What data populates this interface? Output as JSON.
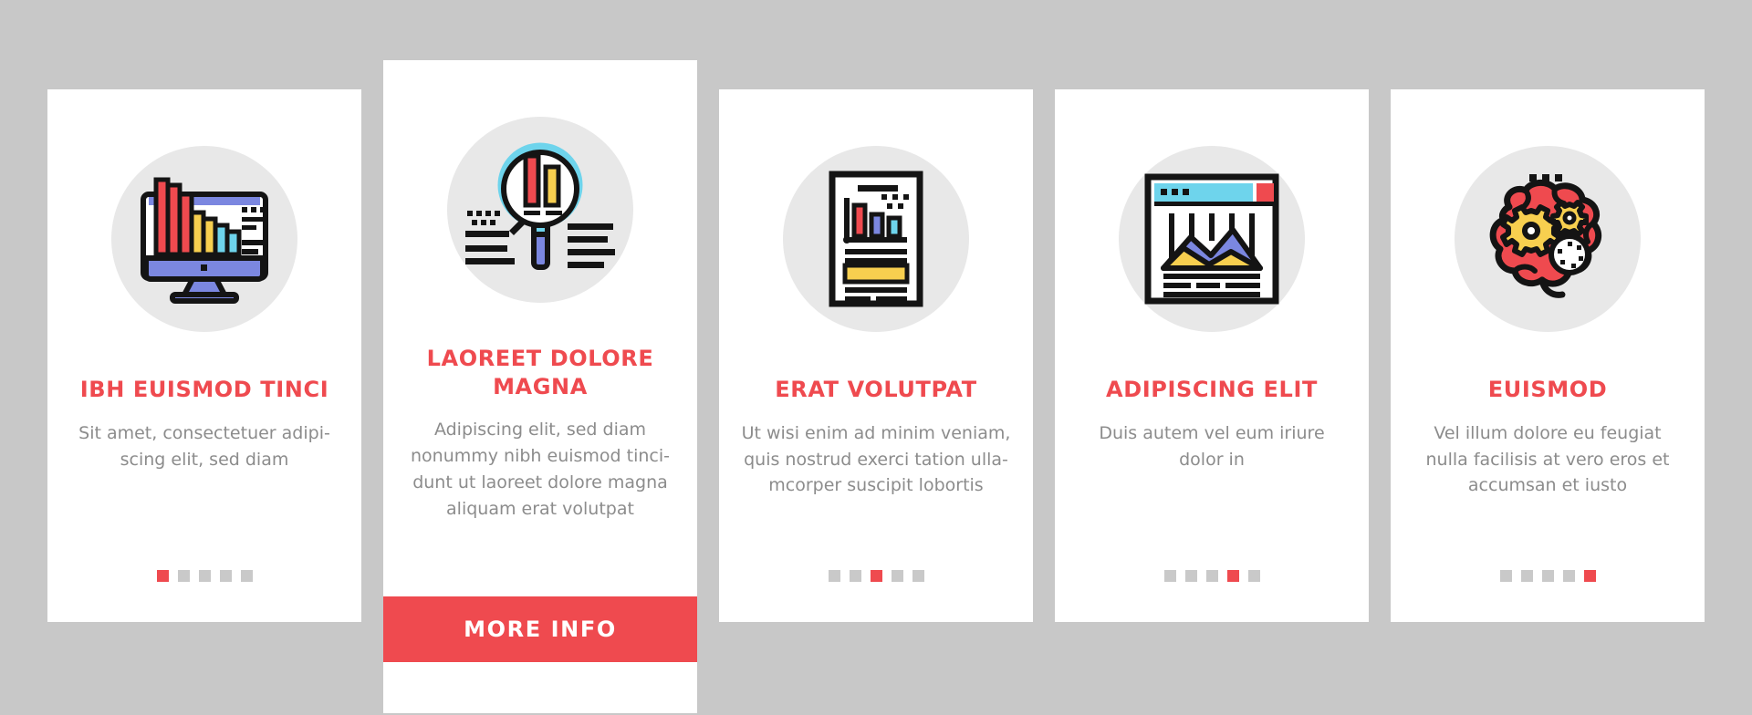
{
  "page": {
    "background_color": "#c8c8c8",
    "accent_color": "#ef4a4f",
    "text_color": "#8c8c8c",
    "card_background": "#ffffff",
    "icon_badge_color": "#e8e8e8"
  },
  "cards": [
    {
      "icon_name": "desktop-monitor-bar-chart-icon",
      "title": "IBH EUISMOD TINCI",
      "description": "Sit amet, consectetuer adipi-\nscing elit, sed diam",
      "dots": {
        "count": 5,
        "active_index": 0
      },
      "cta_label": null
    },
    {
      "icon_name": "magnifier-bar-chart-analysis-icon",
      "title": "LAOREET DOLORE MAGNA",
      "description": "Adipiscing elit, sed diam\nnonummy nibh euismod tinci-\ndunt ut laoreet dolore magna\naliquam erat volutpat",
      "dots": null,
      "cta_label": "MORE INFO"
    },
    {
      "icon_name": "document-report-chart-icon",
      "title": "ERAT VOLUTPAT",
      "description": "Ut wisi enim ad minim veniam,\nquis nostrud exerci tation ulla-\nmcorper suscipit lobortis",
      "dots": {
        "count": 5,
        "active_index": 2
      },
      "cta_label": null
    },
    {
      "icon_name": "browser-window-area-chart-icon",
      "title": "ADIPISCING ELIT",
      "description": "Duis autem vel eum iriure\ndolor in",
      "dots": {
        "count": 5,
        "active_index": 3
      },
      "cta_label": null
    },
    {
      "icon_name": "brain-gears-thinking-icon",
      "title": "EUISMOD",
      "description": "Vel illum dolore eu feugiat\nnulla facilisis at vero eros et\naccumsan et iusto",
      "dots": {
        "count": 5,
        "active_index": 4
      },
      "cta_label": null
    }
  ]
}
